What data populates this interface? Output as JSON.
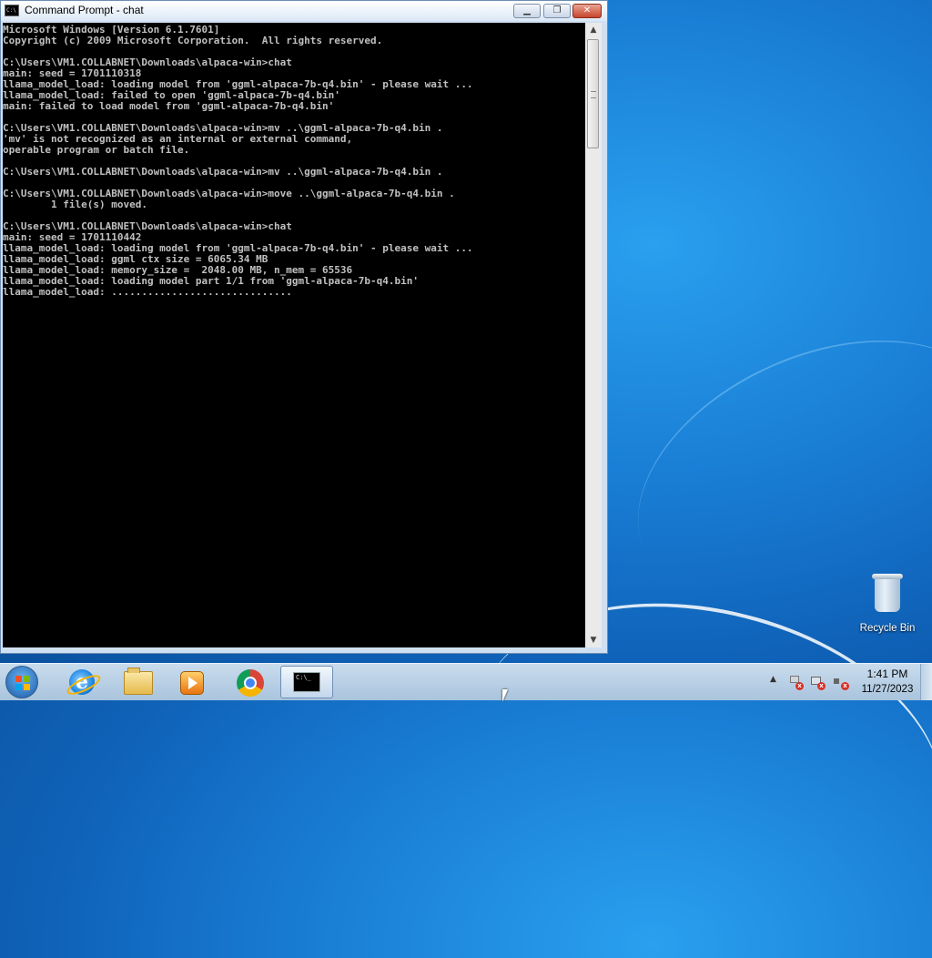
{
  "window": {
    "title": "Command Prompt - chat",
    "minimize_glyph": "▁",
    "maximize_glyph": "❐",
    "close_glyph": "✕",
    "icon_text": "C:\\"
  },
  "console": {
    "text": "Microsoft Windows [Version 6.1.7601]\nCopyright (c) 2009 Microsoft Corporation.  All rights reserved.\n\nC:\\Users\\VM1.COLLABNET\\Downloads\\alpaca-win>chat\nmain: seed = 1701110318\nllama_model_load: loading model from 'ggml-alpaca-7b-q4.bin' - please wait ...\nllama_model_load: failed to open 'ggml-alpaca-7b-q4.bin'\nmain: failed to load model from 'ggml-alpaca-7b-q4.bin'\n\nC:\\Users\\VM1.COLLABNET\\Downloads\\alpaca-win>mv ..\\ggml-alpaca-7b-q4.bin .\n'mv' is not recognized as an internal or external command,\noperable program or batch file.\n\nC:\\Users\\VM1.COLLABNET\\Downloads\\alpaca-win>mv ..\\ggml-alpaca-7b-q4.bin .\n\nC:\\Users\\VM1.COLLABNET\\Downloads\\alpaca-win>move ..\\ggml-alpaca-7b-q4.bin .\n        1 file(s) moved.\n\nC:\\Users\\VM1.COLLABNET\\Downloads\\alpaca-win>chat\nmain: seed = 1701110442\nllama_model_load: loading model from 'ggml-alpaca-7b-q4.bin' - please wait ...\nllama_model_load: ggml ctx size = 6065.34 MB\nllama_model_load: memory_size =  2048.00 MB, n_mem = 65536\nllama_model_load: loading model part 1/1 from 'ggml-alpaca-7b-q4.bin'\nllama_model_load: ..............................",
    "text_color": "#c0c0c0",
    "background": "#000000"
  },
  "scrollbar": {
    "up_glyph": "▲",
    "down_glyph": "▼"
  },
  "desktop": {
    "recycle_bin_label": "Recycle Bin"
  },
  "taskbar": {
    "pinned": [
      {
        "name": "internet-explorer",
        "glyph": "e"
      },
      {
        "name": "windows-explorer"
      },
      {
        "name": "windows-media-player"
      },
      {
        "name": "google-chrome"
      },
      {
        "name": "command-prompt",
        "glyph": "C:\\_"
      }
    ],
    "tray": {
      "show_hidden_glyph": "▲",
      "error_glyph": "x",
      "time": "1:41 PM",
      "date": "11/27/2023"
    }
  },
  "colors": {
    "desktop_blue": "#1a7fd6",
    "close_button": "#c8452d"
  }
}
